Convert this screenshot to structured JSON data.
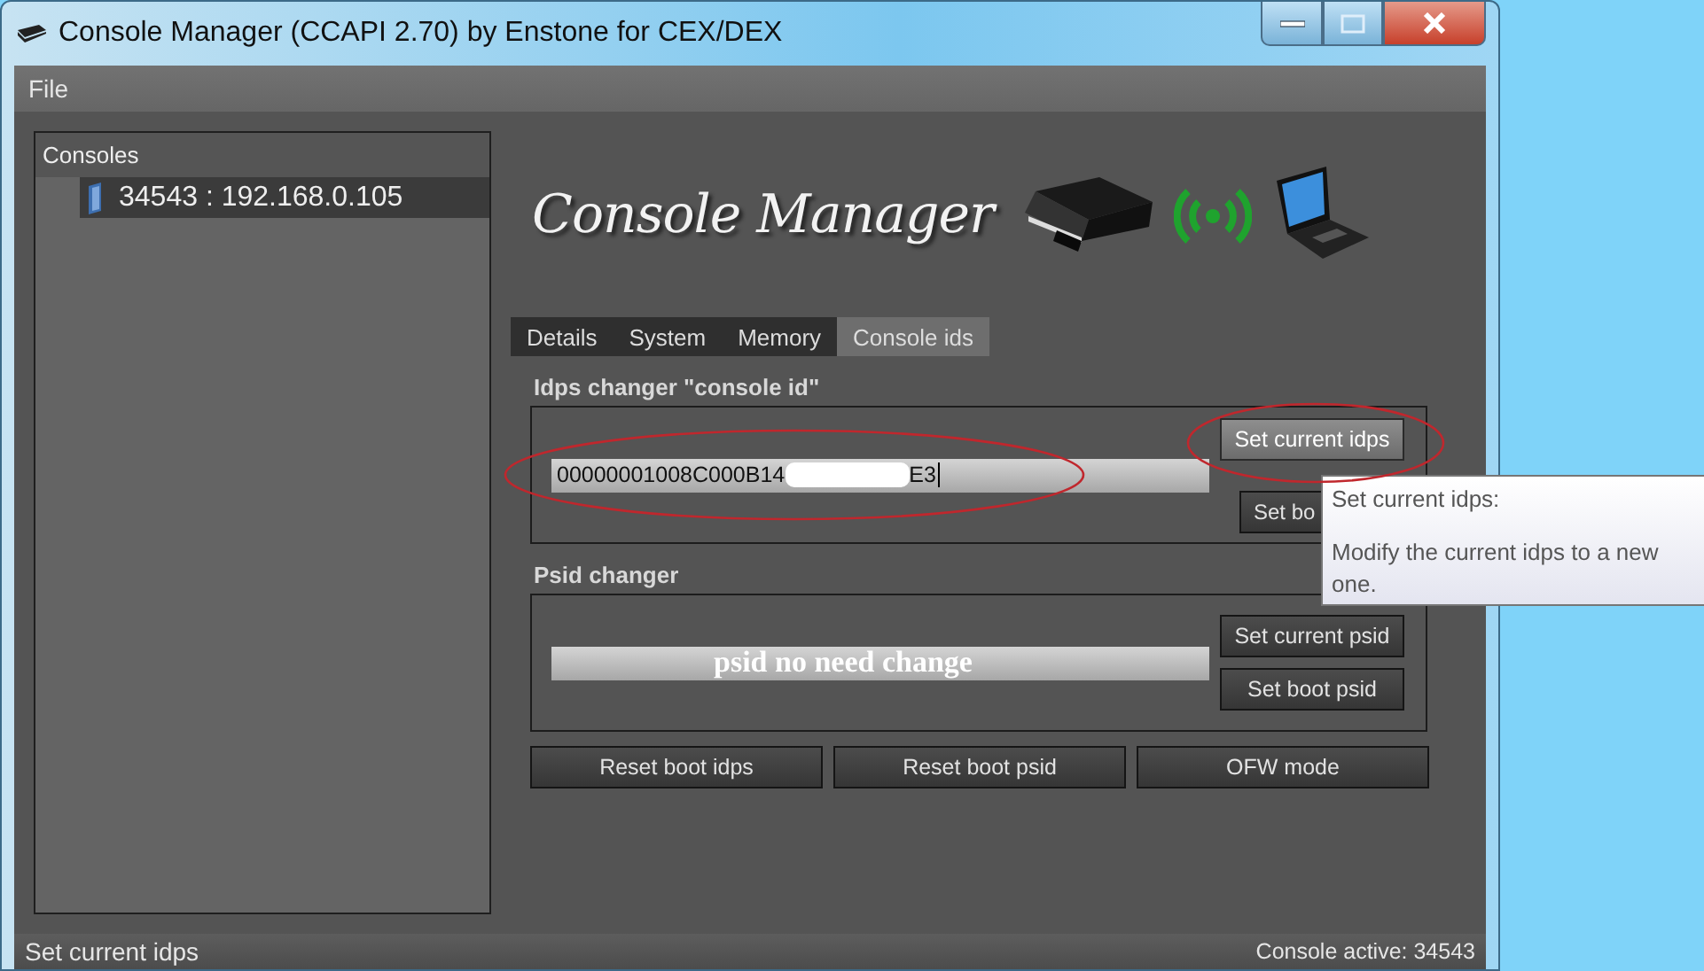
{
  "window": {
    "title": "Console Manager (CCAPI 2.70) by Enstone for CEX/DEX"
  },
  "menu": [
    {
      "label": "File"
    }
  ],
  "consoles": {
    "title": "Consoles",
    "items": [
      {
        "label": "34543 : 192.168.0.105",
        "selected": true
      }
    ]
  },
  "logo": {
    "text": "Console Manager"
  },
  "tabs": [
    {
      "label": "Details",
      "selected": false
    },
    {
      "label": "System",
      "selected": false
    },
    {
      "label": "Memory",
      "selected": false
    },
    {
      "label": "Console ids",
      "selected": true
    }
  ],
  "idps_group": {
    "title": "Idps changer \"console id\"",
    "field": {
      "value_start": "00000001008C000B14",
      "value_end": "E3"
    },
    "buttons": [
      "Set current idps",
      "Set bo"
    ]
  },
  "psid_group": {
    "title": "Psid changer",
    "field": {
      "value": "psid no need change"
    },
    "buttons": [
      "Set current psid",
      "Set boot psid"
    ]
  },
  "actions": [
    "Reset boot idps",
    "Reset boot psid",
    "OFW mode"
  ],
  "tooltip": {
    "title": "Set current idps:",
    "text": "Modify the current idps to a new one."
  },
  "status_bar": {
    "left": "Set current idps",
    "right": "Console active: 34543"
  }
}
